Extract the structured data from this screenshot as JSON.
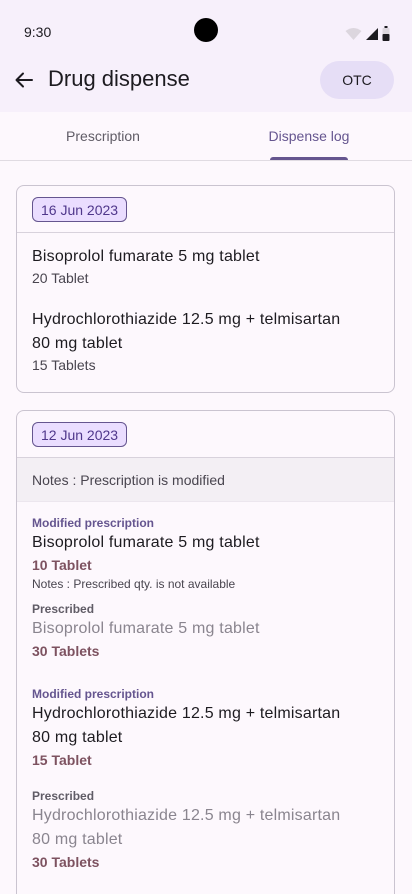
{
  "status_bar": {
    "time": "9:30"
  },
  "top_bar": {
    "title": "Drug dispense",
    "otc_label": "OTC"
  },
  "tabs": [
    {
      "label": "Prescription",
      "selected": false
    },
    {
      "label": "Dispense log",
      "selected": true
    }
  ],
  "cards": [
    {
      "date": "16 Jun 2023",
      "items": [
        {
          "name": "Bisoprolol fumarate 5 mg tablet",
          "qty": "20 Tablet"
        },
        {
          "name_line1": "Hydrochlorothiazide 12.5 mg + telmisartan",
          "name_line2": "80 mg tablet",
          "qty": "15 Tablets"
        }
      ]
    },
    {
      "date": "12 Jun 2023",
      "notes": "Notes : Prescription is modified",
      "modified_items": [
        {
          "modified_label": "Modified prescription",
          "name": "Bisoprolol fumarate 5 mg tablet",
          "qty": "10 Tablet",
          "note": "Notes : Prescribed qty. is not available",
          "prescribed_label": "Prescribed",
          "prescribed_name": "Bisoprolol fumarate 5 mg tablet",
          "prescribed_qty": "30 Tablets"
        },
        {
          "modified_label": "Modified prescription",
          "name_line1": "Hydrochlorothiazide 12.5 mg + telmisartan",
          "name_line2": "80 mg tablet",
          "qty": "15 Tablet",
          "prescribed_label": "Prescribed",
          "prescribed_name_line1": "Hydrochlorothiazide 12.5 mg + telmisartan",
          "prescribed_name_line2": "80 mg tablet",
          "prescribed_qty": "30 Tablets"
        }
      ]
    }
  ],
  "colors": {
    "accent": "#65558f",
    "chip_bg": "#eaddff",
    "qty": "#7d5260"
  }
}
